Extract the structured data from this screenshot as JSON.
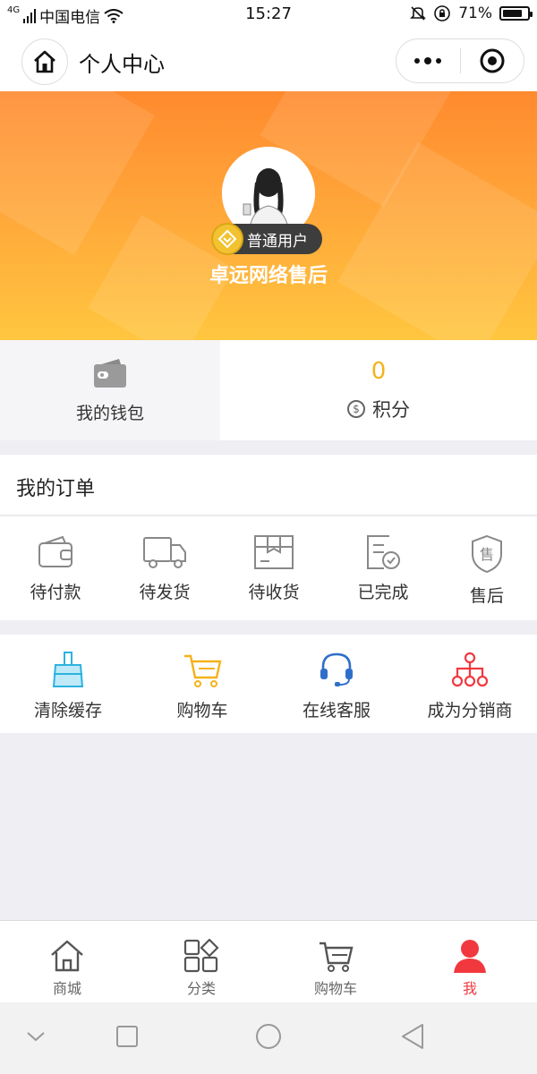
{
  "status_bar": {
    "network": "4G",
    "carrier": "中国电信",
    "time": "15:27",
    "battery": "71%"
  },
  "nav": {
    "title": "个人中心"
  },
  "profile": {
    "user_level": "普通用户",
    "username": "卓远网络售后"
  },
  "wallet": {
    "label": "我的钱包"
  },
  "points": {
    "value": "0",
    "label": "积分"
  },
  "orders": {
    "title": "我的订单",
    "items": [
      {
        "label": "待付款",
        "icon": "wallet-icon"
      },
      {
        "label": "待发货",
        "icon": "truck-icon"
      },
      {
        "label": "待收货",
        "icon": "package-icon"
      },
      {
        "label": "已完成",
        "icon": "checklist-icon"
      },
      {
        "label": "售后",
        "icon": "shield-sale-icon"
      }
    ]
  },
  "tools": {
    "items": [
      {
        "label": "清除缓存",
        "icon": "broom-icon",
        "color": "#2bb3e0"
      },
      {
        "label": "购物车",
        "icon": "cart-icon",
        "color": "#f5b21b"
      },
      {
        "label": "在线客服",
        "icon": "headset-icon",
        "color": "#2f6fc9"
      },
      {
        "label": "成为分销商",
        "icon": "network-icon",
        "color": "#f2383f"
      }
    ]
  },
  "tabbar": {
    "tabs": [
      {
        "label": "商城",
        "icon": "home-icon"
      },
      {
        "label": "分类",
        "icon": "category-icon"
      },
      {
        "label": "购物车",
        "icon": "cart-icon"
      },
      {
        "label": "我",
        "icon": "user-icon",
        "active": true
      }
    ]
  },
  "colors": {
    "accent_orange": "#ff8a2e",
    "points_yellow": "#f5b21b",
    "active_red": "#f2383f"
  }
}
